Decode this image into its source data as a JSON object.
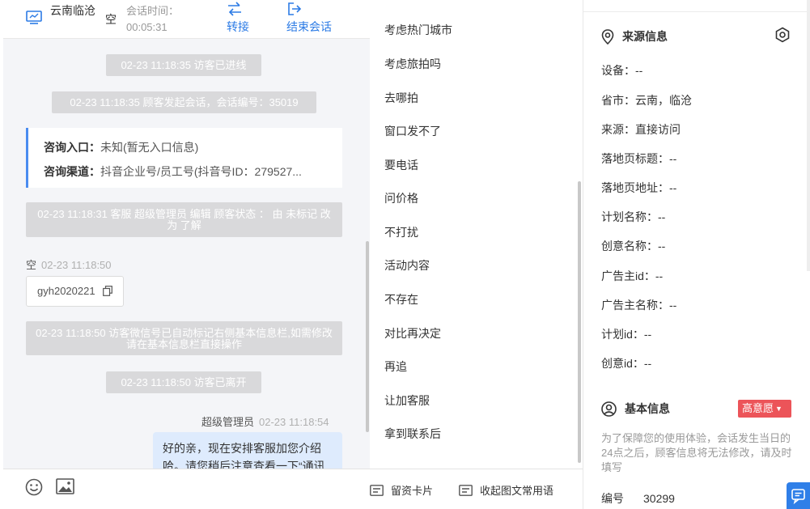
{
  "header": {
    "visitor_name": "云南临沧",
    "visitor_nick": "空",
    "session_label": "会话时间：",
    "session_time": "00:05:31",
    "transfer_label": "转接",
    "end_label": "结束会话"
  },
  "messages": {
    "sys1": "02-23 11:18:35 访客已进线",
    "sys2": "02-23 11:18:35 顾客发起会话，会话编号：35019",
    "inquiry_entry_key": "咨询入口：",
    "inquiry_entry_val": "未知(暂无入口信息)",
    "inquiry_channel_key": "咨询渠道：",
    "inquiry_channel_val": "抖音企业号/员工号(抖音号ID：279527...",
    "sys3": "02-23 11:18:31 客服 超级管理员 编辑 顾客状态 ： 由 未标记 改为 了解",
    "visitor_sender": "空",
    "visitor_time": "02-23 11:18:50",
    "visitor_wechat": "gyh2020221",
    "sys4": "02-23 11:18:50 访客微信号已自动标记右侧基本信息栏,如需修改请在基本信息栏直接操作",
    "sys5": "02-23 11:18:50 访客已离开",
    "agent_sender": "超级管理员",
    "agent_time": "02-23 11:18:54",
    "agent_text": "好的亲，现在安排客服加您介绍哈。请您稍后注意查看一下“通讯"
  },
  "toolbar": {
    "emoji_icon": "smiley-icon",
    "image_icon": "image-icon",
    "card_label": "留资卡片",
    "collapse_label": "收起图文常用语"
  },
  "quick_replies": [
    "考虑热门城市",
    "考虑旅拍吗",
    "去哪拍",
    "窗口发不了",
    "要电话",
    "问价格",
    "不打扰",
    "活动内容",
    "不存在",
    "对比再决定",
    "再追",
    "让加客服",
    "拿到联系后"
  ],
  "source_info": {
    "title": "来源信息",
    "device": "设备：--",
    "province": "省市：云南，临沧",
    "source": "来源：直接访问",
    "landing_title": "落地页标题：--",
    "landing_url": "落地页地址：--",
    "plan_name": "计划名称：--",
    "creative_name": "创意名称：--",
    "advertiser_id": "广告主id：--",
    "advertiser_name": "广告主名称：--",
    "plan_id": "计划id：--",
    "creative_id": "创意id：--"
  },
  "basic_info": {
    "title": "基本信息",
    "intent_badge": "高意愿",
    "notice": "为了保障您的使用体验，会话发生当日的24点之后，顾客信息将无法修改，请及时填写",
    "id_label": "编号",
    "id_value": "30299"
  },
  "colors": {
    "accent": "#2c7be5",
    "badge_red": "#ec5459",
    "agent_bubble": "#deebfd",
    "system_pill": "#d9d9db"
  }
}
